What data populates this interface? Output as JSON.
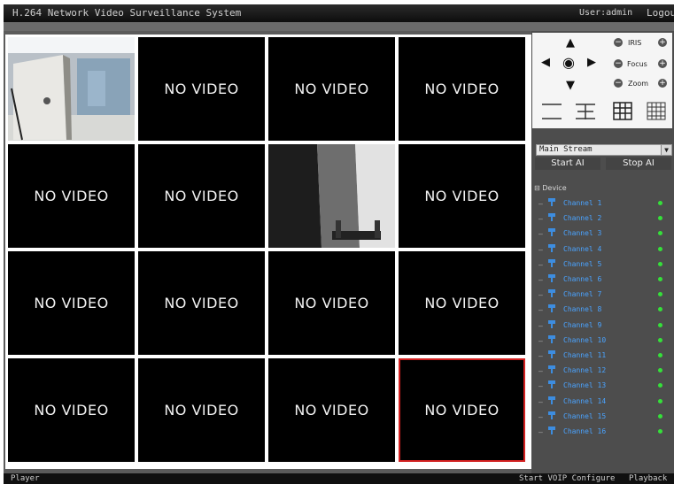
{
  "app": {
    "title": "H.264 Network Video Surveillance System",
    "user_label": "User:admin",
    "logout_label": "Logout"
  },
  "grid": {
    "no_video_text": "NO VIDEO",
    "cells": [
      {
        "state": "video",
        "camera": "camera-feed-office"
      },
      {
        "state": "no_video"
      },
      {
        "state": "no_video"
      },
      {
        "state": "no_video"
      },
      {
        "state": "no_video"
      },
      {
        "state": "no_video"
      },
      {
        "state": "video",
        "camera": "camera-feed-door"
      },
      {
        "state": "no_video"
      },
      {
        "state": "no_video"
      },
      {
        "state": "no_video"
      },
      {
        "state": "no_video"
      },
      {
        "state": "no_video"
      },
      {
        "state": "no_video"
      },
      {
        "state": "no_video"
      },
      {
        "state": "no_video"
      },
      {
        "state": "no_video",
        "selected": true
      }
    ],
    "selected_border_color": "#d32020"
  },
  "ptz": {
    "iris_label": "IRIS",
    "focus_label": "Focus",
    "zoom_label": "Zoom",
    "icons": [
      "arrow-up-icon",
      "arrow-left-icon",
      "ptz-center-icon",
      "arrow-right-icon",
      "arrow-down-icon"
    ],
    "layouts": [
      "layout-1x1-icon",
      "layout-2x2-icon",
      "layout-3x3-icon",
      "layout-4x4-icon"
    ]
  },
  "stream": {
    "selected": "Main Stream",
    "start_ai": "Start AI",
    "stop_ai": "Stop AI"
  },
  "device_tree": {
    "root_label": "Device",
    "status_color": "#35e03a",
    "channels": [
      "Channel  1",
      "Channel  2",
      "Channel  3",
      "Channel  4",
      "Channel  5",
      "Channel  6",
      "Channel  7",
      "Channel  8",
      "Channel  9",
      "Channel  10",
      "Channel  11",
      "Channel  12",
      "Channel  13",
      "Channel  14",
      "Channel  15",
      "Channel  16"
    ]
  },
  "statusbar": {
    "player": "Player",
    "voip": "Start VOIP Configure",
    "playback": "Playback"
  }
}
